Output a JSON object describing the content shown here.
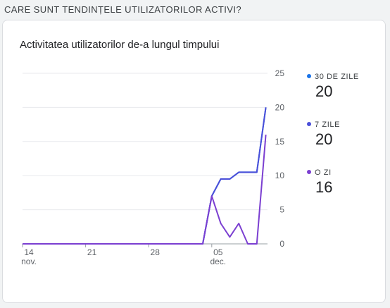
{
  "section": {
    "title": "CARE SUNT TENDINȚELE UTILIZATORILOR ACTIVI?"
  },
  "card": {
    "title": "Activitatea utilizatorilor de-a lungul timpului"
  },
  "legend": [
    {
      "label": "30 DE ZILE",
      "value": "20",
      "color": "#1a73e8"
    },
    {
      "label": "7 ZILE",
      "value": "20",
      "color": "#4b4fd9"
    },
    {
      "label": "O ZI",
      "value": "16",
      "color": "#7b3fd1"
    }
  ],
  "chart_data": {
    "type": "line",
    "x_ticks": [
      {
        "label": "14",
        "sublabel": "nov.",
        "day": 0
      },
      {
        "label": "21",
        "sublabel": "",
        "day": 7
      },
      {
        "label": "28",
        "sublabel": "",
        "day": 14
      },
      {
        "label": "05",
        "sublabel": "dec.",
        "day": 21
      }
    ],
    "ylim": [
      0,
      25
    ],
    "y_ticks": [
      0,
      5,
      10,
      15,
      20,
      25
    ],
    "grid": true,
    "series": [
      {
        "name": "30 DE ZILE",
        "color": "#1a73e8",
        "points": [
          [
            0,
            0
          ],
          [
            20,
            0
          ],
          [
            21,
            7
          ],
          [
            22,
            9.5
          ],
          [
            23,
            9.5
          ],
          [
            24,
            10.5
          ],
          [
            25,
            10.5
          ],
          [
            26,
            10.5
          ],
          [
            27,
            20
          ]
        ]
      },
      {
        "name": "7 ZILE",
        "color": "#4b4fd9",
        "points": [
          [
            0,
            0
          ],
          [
            20,
            0
          ],
          [
            21,
            7
          ],
          [
            22,
            9.5
          ],
          [
            23,
            9.5
          ],
          [
            24,
            10.5
          ],
          [
            25,
            10.5
          ],
          [
            26,
            10.5
          ],
          [
            27,
            20
          ]
        ]
      },
      {
        "name": "O ZI",
        "color": "#7b3fd1",
        "points": [
          [
            0,
            0
          ],
          [
            20,
            0
          ],
          [
            21,
            7
          ],
          [
            22,
            3
          ],
          [
            23,
            1
          ],
          [
            24,
            3
          ],
          [
            25,
            0
          ],
          [
            26,
            0
          ],
          [
            27,
            16
          ]
        ]
      }
    ]
  }
}
